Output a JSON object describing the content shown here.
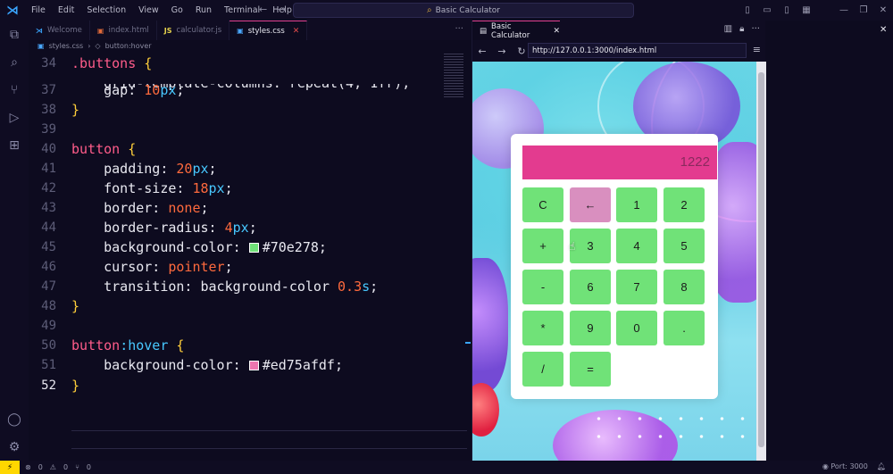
{
  "window": {
    "menu": [
      "File",
      "Edit",
      "Selection",
      "View",
      "Go",
      "Run",
      "Terminal",
      "Help"
    ],
    "command_center": "Basic Calculator"
  },
  "editor": {
    "tabs": [
      {
        "label": "Welcome",
        "icon": "vscode-icon"
      },
      {
        "label": "index.html",
        "icon": "html-icon"
      },
      {
        "label": "calculator.js",
        "icon": "js-icon"
      },
      {
        "label": "styles.css",
        "icon": "css-icon",
        "active": true
      }
    ],
    "breadcrumb": [
      "styles.css",
      "button:hover"
    ],
    "lines": [
      {
        "num": "34",
        "text": ".buttons {"
      },
      {
        "num": "37",
        "text": "gap: 10px;"
      },
      {
        "num": "38",
        "text": "}"
      },
      {
        "num": "40",
        "text": "button {"
      },
      {
        "num": "41",
        "text": "padding: 20px;"
      },
      {
        "num": "42",
        "text": "font-size: 18px;"
      },
      {
        "num": "43",
        "text": "border: none;"
      },
      {
        "num": "44",
        "text": "border-radius: 4px;"
      },
      {
        "num": "45",
        "text": "background-color: #70e278;"
      },
      {
        "num": "46",
        "text": "cursor: pointer;"
      },
      {
        "num": "47",
        "text": "transition: background-color 0.3s;"
      },
      {
        "num": "48",
        "text": "}"
      },
      {
        "num": "50",
        "text": "button:hover {"
      },
      {
        "num": "51",
        "text": "background-color: #ed75afdf;"
      },
      {
        "num": "52",
        "text": "}"
      }
    ],
    "empty_line_nums": [
      "39",
      "49"
    ]
  },
  "browser": {
    "tab_title": "Basic Calculator",
    "url": "http://127.0.0.1:3000/index.html"
  },
  "calculator": {
    "display": "1222",
    "buttons": [
      "C",
      "←",
      "1",
      "2",
      "+",
      "3",
      "4",
      "5",
      "-",
      "6",
      "7",
      "8",
      "*",
      "9",
      "0",
      ".",
      "/",
      "="
    ],
    "colors": {
      "button": "#70e278",
      "hover": "#ed75afdf",
      "display": "#e33b8f"
    }
  },
  "statusbar": {
    "errors": "0",
    "warnings": "0",
    "ports_count": "0",
    "port": "Port: 3000"
  }
}
